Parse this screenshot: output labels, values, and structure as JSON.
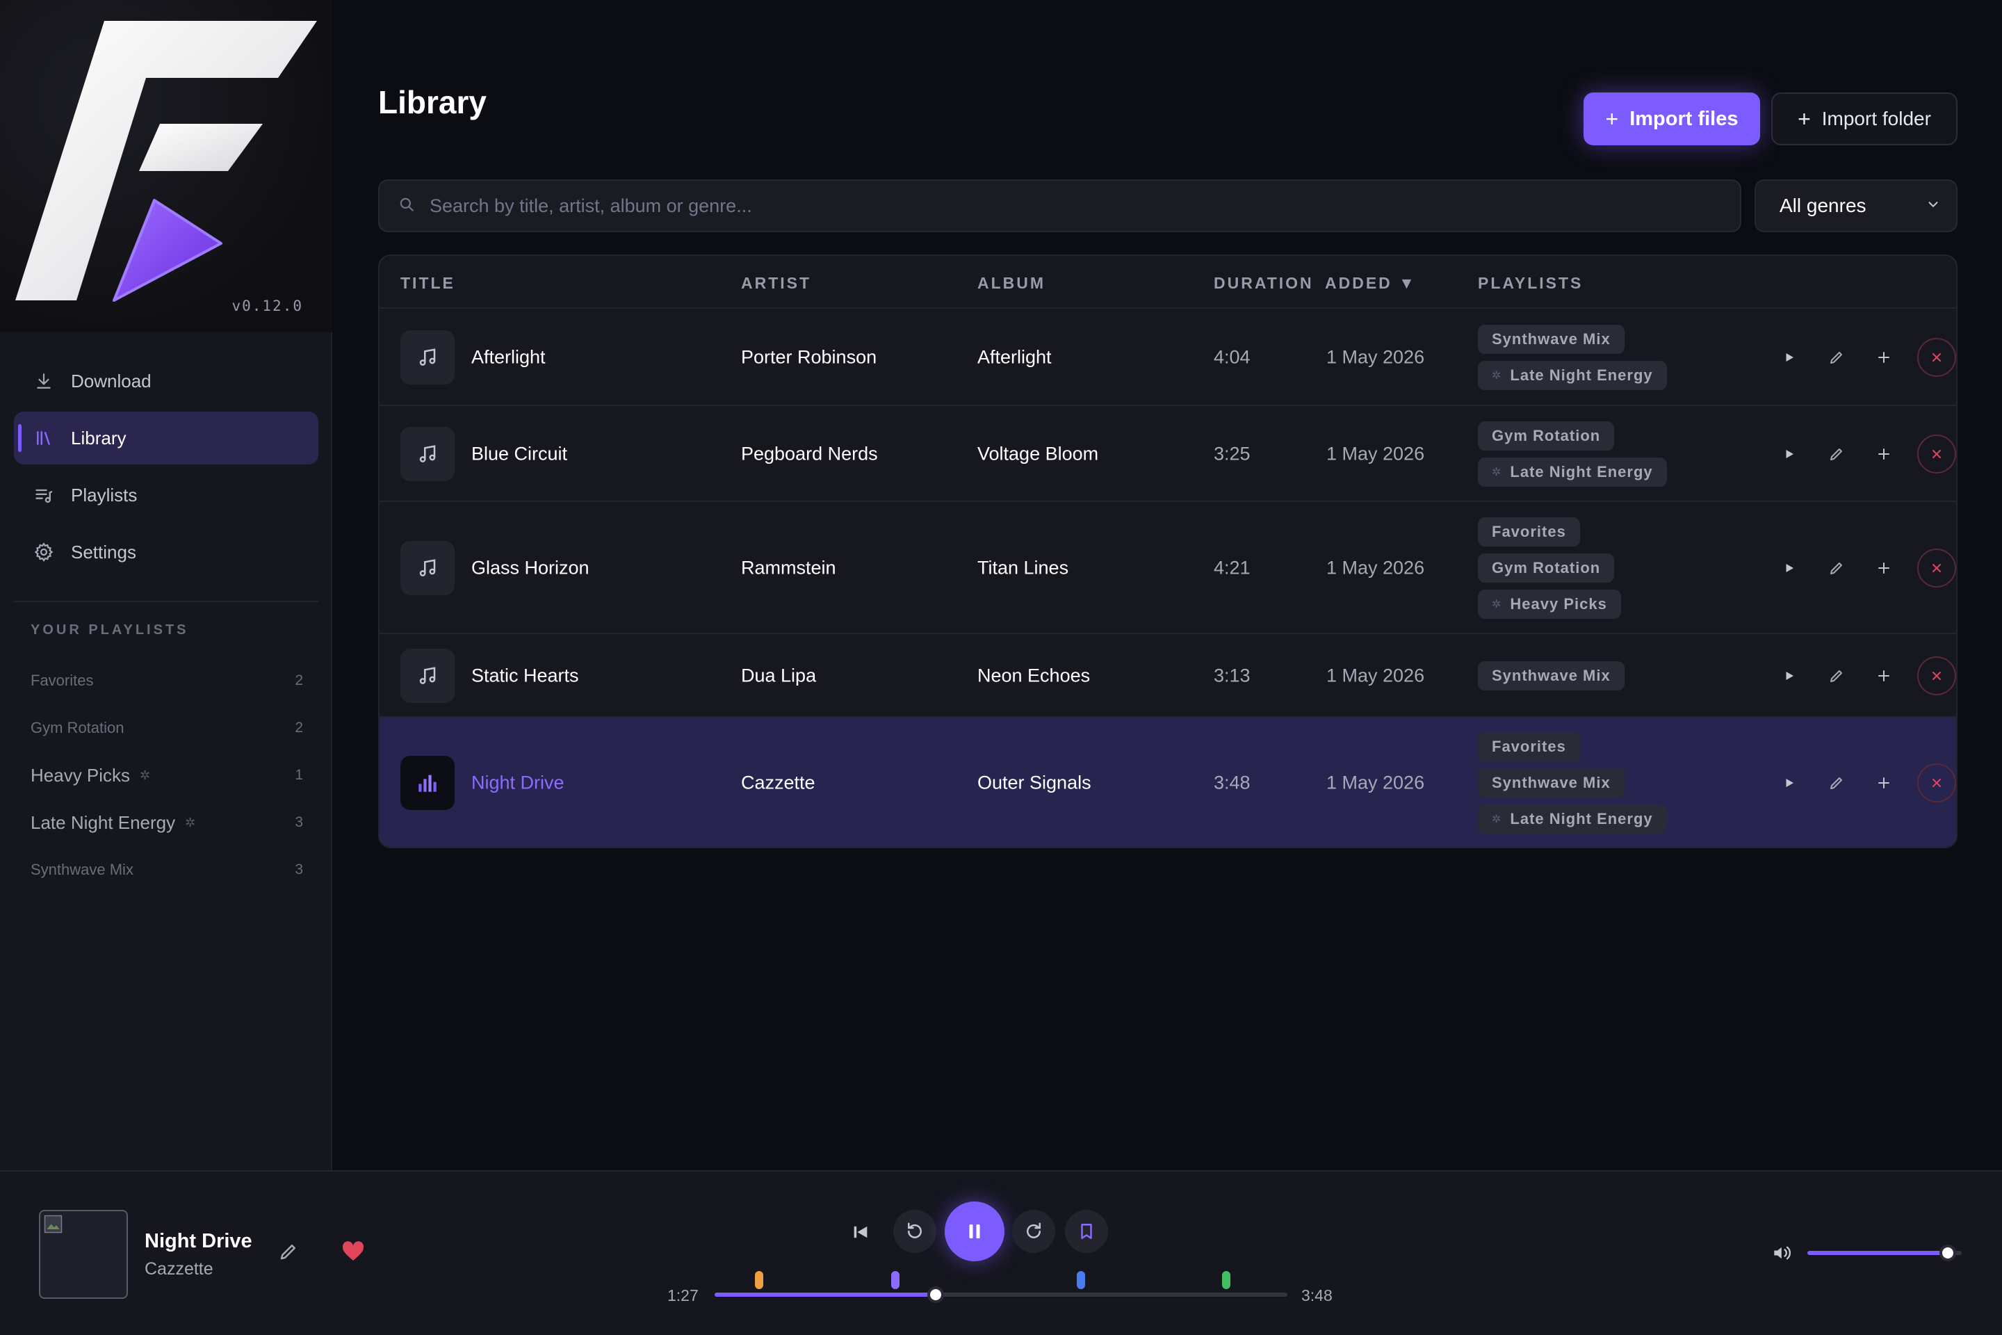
{
  "app": {
    "version": "v0.12.0",
    "accent_color": "#7c5cff",
    "danger_color": "#e0455a"
  },
  "sidebar": {
    "nav": [
      {
        "label": "Download",
        "icon": "download-icon"
      },
      {
        "label": "Library",
        "icon": "library-icon",
        "active": true
      },
      {
        "label": "Playlists",
        "icon": "playlists-icon"
      },
      {
        "label": "Settings",
        "icon": "gear-icon"
      }
    ],
    "your_playlists_title": "YOUR PLAYLISTS",
    "playlists": [
      {
        "name": "Favorites",
        "count": "2"
      },
      {
        "name": "Gym Rotation",
        "count": "2"
      },
      {
        "name": "Heavy Picks",
        "count": "1",
        "smart": true
      },
      {
        "name": "Late Night Energy",
        "count": "3",
        "smart": true
      },
      {
        "name": "Synthwave Mix",
        "count": "3"
      }
    ]
  },
  "header": {
    "title": "Library",
    "import_files_label": "Import files",
    "import_folder_label": "Import folder"
  },
  "search": {
    "placeholder": "Search by title, artist, album or genre...",
    "value": ""
  },
  "genre_filter": {
    "selected": "All genres"
  },
  "table": {
    "columns": [
      "TITLE",
      "ARTIST",
      "ALBUM",
      "DURATION",
      "ADDED ▼",
      "PLAYLISTS"
    ],
    "rows": [
      {
        "title": "Afterlight",
        "artist": "Porter Robinson",
        "album": "Afterlight",
        "duration": "4:04",
        "added": "1 May 2026",
        "playlists": [
          {
            "name": "Synthwave Mix",
            "smart": false
          },
          {
            "name": "Late Night Energy",
            "smart": true
          }
        ]
      },
      {
        "title": "Blue Circuit",
        "artist": "Pegboard Nerds",
        "album": "Voltage Bloom",
        "duration": "3:25",
        "added": "1 May 2026",
        "playlists": [
          {
            "name": "Gym Rotation",
            "smart": false
          },
          {
            "name": "Late Night Energy",
            "smart": true
          }
        ]
      },
      {
        "title": "Glass Horizon",
        "artist": "Rammstein",
        "album": "Titan Lines",
        "duration": "4:21",
        "added": "1 May 2026",
        "playlists": [
          {
            "name": "Favorites",
            "smart": false
          },
          {
            "name": "Gym Rotation",
            "smart": false
          },
          {
            "name": "Heavy Picks",
            "smart": true
          }
        ]
      },
      {
        "title": "Static Hearts",
        "artist": "Dua Lipa",
        "album": "Neon Echoes",
        "duration": "3:13",
        "added": "1 May 2026",
        "playlists": [
          {
            "name": "Synthwave Mix",
            "smart": false
          }
        ]
      },
      {
        "title": "Night Drive",
        "artist": "Cazzette",
        "album": "Outer Signals",
        "duration": "3:48",
        "added": "1 May 2026",
        "playing": true,
        "playlists": [
          {
            "name": "Favorites",
            "smart": false
          },
          {
            "name": "Synthwave Mix",
            "smart": false
          },
          {
            "name": "Late Night Energy",
            "smart": true
          }
        ]
      }
    ]
  },
  "player": {
    "title": "Night Drive",
    "artist": "Cazzette",
    "elapsed": "1:27",
    "total": "3:48",
    "progress": 0.386,
    "volume": 0.91,
    "liked": true,
    "markers": [
      {
        "position": 0.078,
        "color": "#f0a040"
      },
      {
        "position": 0.315,
        "color": "#8c6cff"
      },
      {
        "position": 0.64,
        "color": "#4a7cf0"
      },
      {
        "position": 0.893,
        "color": "#40c060"
      }
    ]
  }
}
